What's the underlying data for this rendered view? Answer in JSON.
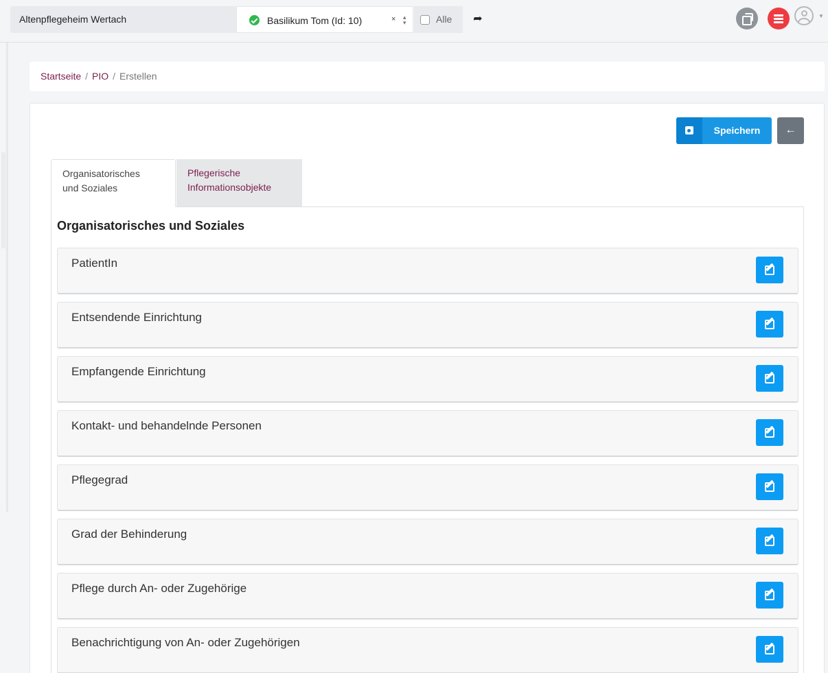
{
  "topbar": {
    "facility": "Altenpflegeheim Wertach",
    "patient": "Basilikum Tom (Id: 10)",
    "clear": "×",
    "alle_label": "Alle"
  },
  "icons": {
    "forward": "share-icon",
    "windows": "windows-icon",
    "list": "list-icon",
    "user": "user-icon"
  },
  "breadcrumb": {
    "home": "Startseite",
    "section": "PIO",
    "current": "Erstellen",
    "sep": "/"
  },
  "actions": {
    "save_label": "Speichern"
  },
  "tabs": [
    {
      "label_line1": "Organisatorisches",
      "label_line2": "und Soziales"
    },
    {
      "label_line1": "Pflegerische",
      "label_line2": "Informationsobjekte"
    }
  ],
  "section_title": "Organisatorisches und Soziales",
  "items": [
    {
      "label": "PatientIn"
    },
    {
      "label": "Entsendende Einrichtung"
    },
    {
      "label": "Empfangende Einrichtung"
    },
    {
      "label": "Kontakt- und behandelnde Personen"
    },
    {
      "label": "Pflegegrad"
    },
    {
      "label": "Grad der Behinderung"
    },
    {
      "label": "Pflege durch An- oder Zugehörige"
    },
    {
      "label": "Benachrichtigung von An- oder Zugehörigen"
    }
  ],
  "colors": {
    "accent_link": "#7b1f4f",
    "save_blue": "#1a97e4",
    "edit_blue": "#0d9cf3",
    "ok_green": "#2db84d",
    "alert_red": "#ee3b42"
  }
}
